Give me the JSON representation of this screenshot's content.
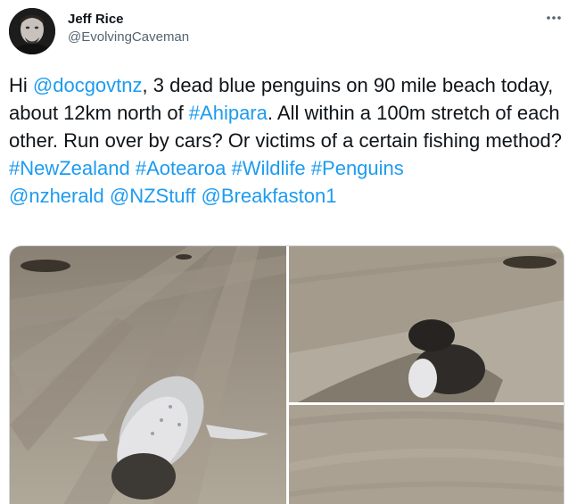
{
  "author": {
    "display_name": "Jeff Rice",
    "handle": "@EvolvingCaveman"
  },
  "icons": {
    "more": "more-horizontal-icon",
    "avatar": "profile-photo"
  },
  "tweet": {
    "segments": [
      {
        "text": "Hi ",
        "link": false
      },
      {
        "text": "@docgovtnz",
        "link": true
      },
      {
        "text": ", 3 dead blue penguins on 90 mile beach today, about 12km north of ",
        "link": false
      },
      {
        "text": "#Ahipara",
        "link": true
      },
      {
        "text": ". All within a 100m stretch of each other. Run over by cars? Or victims of a certain fishing method?\n",
        "link": false
      },
      {
        "text": "#NewZealand",
        "link": true
      },
      {
        "text": " ",
        "link": false
      },
      {
        "text": "#Aotearoa",
        "link": true
      },
      {
        "text": " ",
        "link": false
      },
      {
        "text": "#Wildlife",
        "link": true
      },
      {
        "text": " ",
        "link": false
      },
      {
        "text": "#Penguins",
        "link": true
      },
      {
        "text": "\n",
        "link": false
      },
      {
        "text": "@nzherald",
        "link": true
      },
      {
        "text": " ",
        "link": false
      },
      {
        "text": "@NZStuff",
        "link": true
      },
      {
        "text": " ",
        "link": false
      },
      {
        "text": "@Breakfaston1",
        "link": true
      }
    ]
  },
  "colors": {
    "link": "#1d9bf0",
    "text": "#0f1419",
    "secondary": "#536471",
    "border": "#cfd9de"
  }
}
